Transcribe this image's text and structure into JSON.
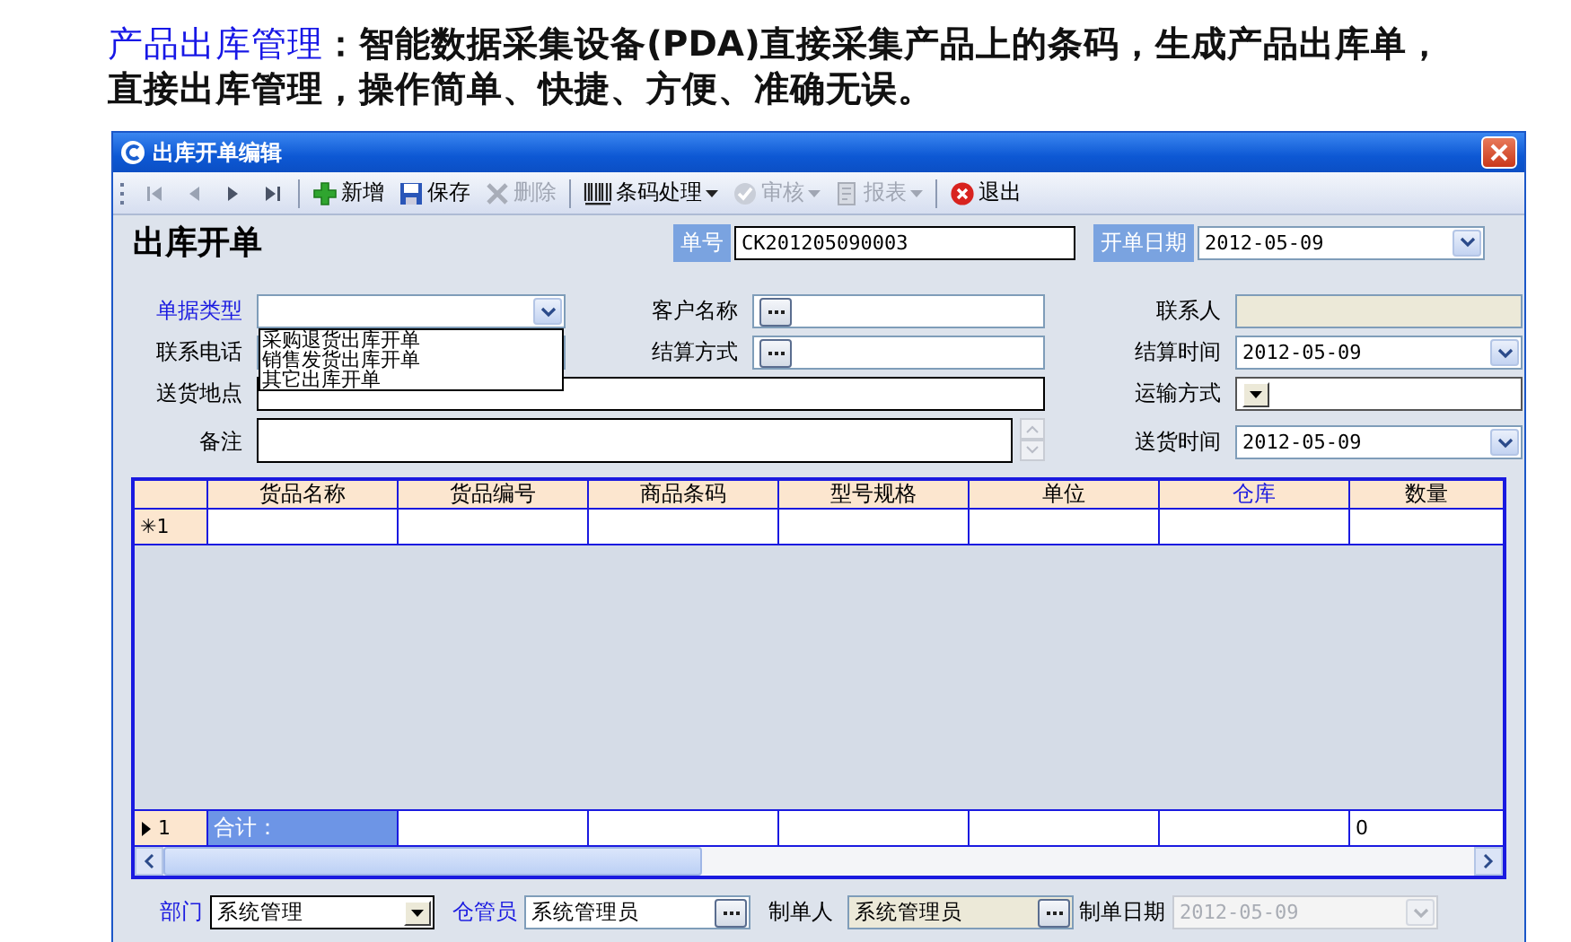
{
  "heading": {
    "title": "产品出库管理",
    "text": "：智能数据采集设备(PDA)直接采集产品上的条码，生成产品出库单，直接出库管理，操作简单、快捷、方便、准确无误。"
  },
  "window": {
    "title": "出库开单编辑"
  },
  "toolbar": [
    {
      "kind": "nav",
      "disabled": true
    },
    {
      "kind": "nav",
      "disabled": true
    },
    {
      "kind": "nav",
      "disabled": false
    },
    {
      "kind": "nav",
      "disabled": false
    },
    {
      "kind": "separator"
    },
    {
      "kind": "button",
      "label": "新增",
      "disabled": false,
      "menu": false
    },
    {
      "kind": "button",
      "label": "保存",
      "disabled": false,
      "menu": false
    },
    {
      "kind": "button",
      "label": "删除",
      "disabled": true,
      "menu": false
    },
    {
      "kind": "separator"
    },
    {
      "kind": "button",
      "label": "条码处理",
      "disabled": false,
      "menu": true
    },
    {
      "kind": "button",
      "label": "审核",
      "disabled": true,
      "menu": true
    },
    {
      "kind": "button",
      "label": "报表",
      "disabled": true,
      "menu": true
    },
    {
      "kind": "separator"
    },
    {
      "kind": "button",
      "label": "退出",
      "disabled": false,
      "menu": false
    }
  ],
  "form_title": "出库开单",
  "order_no": {
    "label": "单号",
    "value": "CK201205090003"
  },
  "order_date": {
    "label": "开单日期",
    "value": "2012-05-09"
  },
  "fields": [
    {
      "label": "单据类型",
      "kind": "select",
      "highlighted": true,
      "expanded": true,
      "options": [
        "采购退货出库开单",
        "销售发货出库开单",
        "其它出库开单"
      ]
    },
    {
      "label": "客户名称",
      "kind": "lookup",
      "highlighted": false
    },
    {
      "label": "联系人",
      "kind": "readonly",
      "highlighted": false
    },
    {
      "label": "联系电话",
      "kind": "text",
      "highlighted": false
    },
    {
      "label": "结算方式",
      "kind": "lookup",
      "highlighted": false
    },
    {
      "label": "结算时间",
      "kind": "date",
      "highlighted": false,
      "value": "2012-05-09"
    },
    {
      "label": "送货地点",
      "kind": "wide",
      "highlighted": false
    },
    {
      "label": "运输方式",
      "kind": "combo",
      "highlighted": false
    },
    {
      "label": "备注",
      "kind": "memo",
      "highlighted": false
    },
    {
      "label": "送货时间",
      "kind": "date",
      "highlighted": false,
      "value": "2012-05-09"
    }
  ],
  "table": {
    "columns": [
      {
        "label": "货品名称",
        "highlighted": false
      },
      {
        "label": "货品编号",
        "highlighted": false
      },
      {
        "label": "商品条码",
        "highlighted": false
      },
      {
        "label": "型号规格",
        "highlighted": false
      },
      {
        "label": "单位",
        "highlighted": false
      },
      {
        "label": "仓库",
        "highlighted": true
      },
      {
        "label": "数量",
        "highlighted": false
      }
    ],
    "new_row": {
      "marker": "✳1"
    },
    "total_row": {
      "marker": "1",
      "label": "合计：",
      "quantity": "0"
    }
  },
  "footer": [
    {
      "label": "部门",
      "kind": "combo",
      "highlighted": true,
      "value": "系统管理"
    },
    {
      "label": "仓管员",
      "kind": "lookup",
      "highlighted": true,
      "value": "系统管理员"
    },
    {
      "label": "制单人",
      "kind": "readonly-lookup",
      "highlighted": false,
      "value": "系统管理员"
    },
    {
      "label": "制单日期",
      "kind": "date",
      "highlighted": false,
      "disabled": true,
      "value": "2012-05-09"
    }
  ]
}
